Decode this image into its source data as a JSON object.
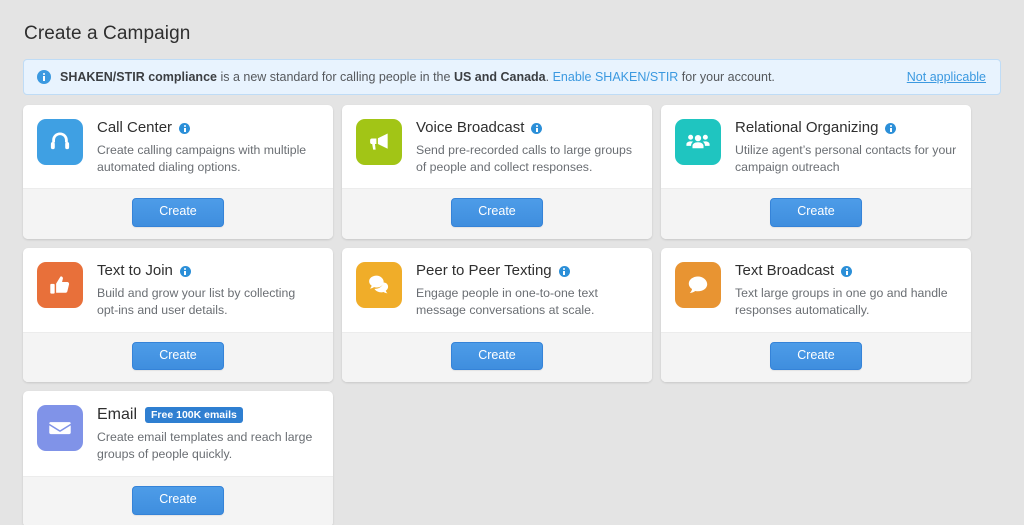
{
  "page_title": "Create a Campaign",
  "banner": {
    "icon": "info-circle-icon",
    "text_lead": "SHAKEN/STIR compliance",
    "text_mid": " is a new standard for calling people in the ",
    "text_bold2": "US and Canada",
    "text_sep": ". ",
    "link": "Enable SHAKEN/STIR",
    "text_tail": " for your account.",
    "action": "Not applicable",
    "bg_color": "#e8f3fe",
    "border_color": "#bfdcf6",
    "link_color": "#3b99e0"
  },
  "cards": [
    {
      "id": "call-center",
      "title": "Call Center",
      "desc": "Create calling campaigns with multiple automated dialing options.",
      "icon": "headset-icon",
      "icon_color": "#3fa0e3",
      "has_info": true,
      "button": "Create"
    },
    {
      "id": "voice-broadcast",
      "title": "Voice Broadcast",
      "desc": "Send pre-recorded calls to large groups of people and collect responses.",
      "icon": "megaphone-icon",
      "icon_color": "#a2c516",
      "has_info": true,
      "button": "Create"
    },
    {
      "id": "relational-organizing",
      "title": "Relational Organizing",
      "desc": "Utilize agent’s personal contacts for your campaign outreach",
      "icon": "people-group-icon",
      "icon_color": "#1fc5c0",
      "has_info": true,
      "button": "Create"
    },
    {
      "id": "text-to-join",
      "title": "Text to Join",
      "desc": "Build and grow your list by collecting opt-ins and user details.",
      "icon": "thumbs-up-icon",
      "icon_color": "#e8703a",
      "has_info": true,
      "button": "Create"
    },
    {
      "id": "peer-to-peer-texting",
      "title": "Peer to Peer Texting",
      "desc": "Engage people in one-to-one text message conversations at scale.",
      "icon": "double-chat-bubble-icon",
      "icon_color": "#f0ad29",
      "has_info": true,
      "button": "Create"
    },
    {
      "id": "text-broadcast",
      "title": "Text Broadcast",
      "desc": "Text large groups in one go and handle responses automatically.",
      "icon": "chat-bubble-icon",
      "icon_color": "#e89432",
      "has_info": true,
      "button": "Create"
    },
    {
      "id": "email",
      "title": "Email",
      "desc": "Create email templates and reach large groups of people quickly.",
      "icon": "envelope-icon",
      "icon_color": "#8093e8",
      "has_info": false,
      "badge": "Free 100K emails",
      "badge_color": "#2f7fd1",
      "button": "Create"
    }
  ]
}
